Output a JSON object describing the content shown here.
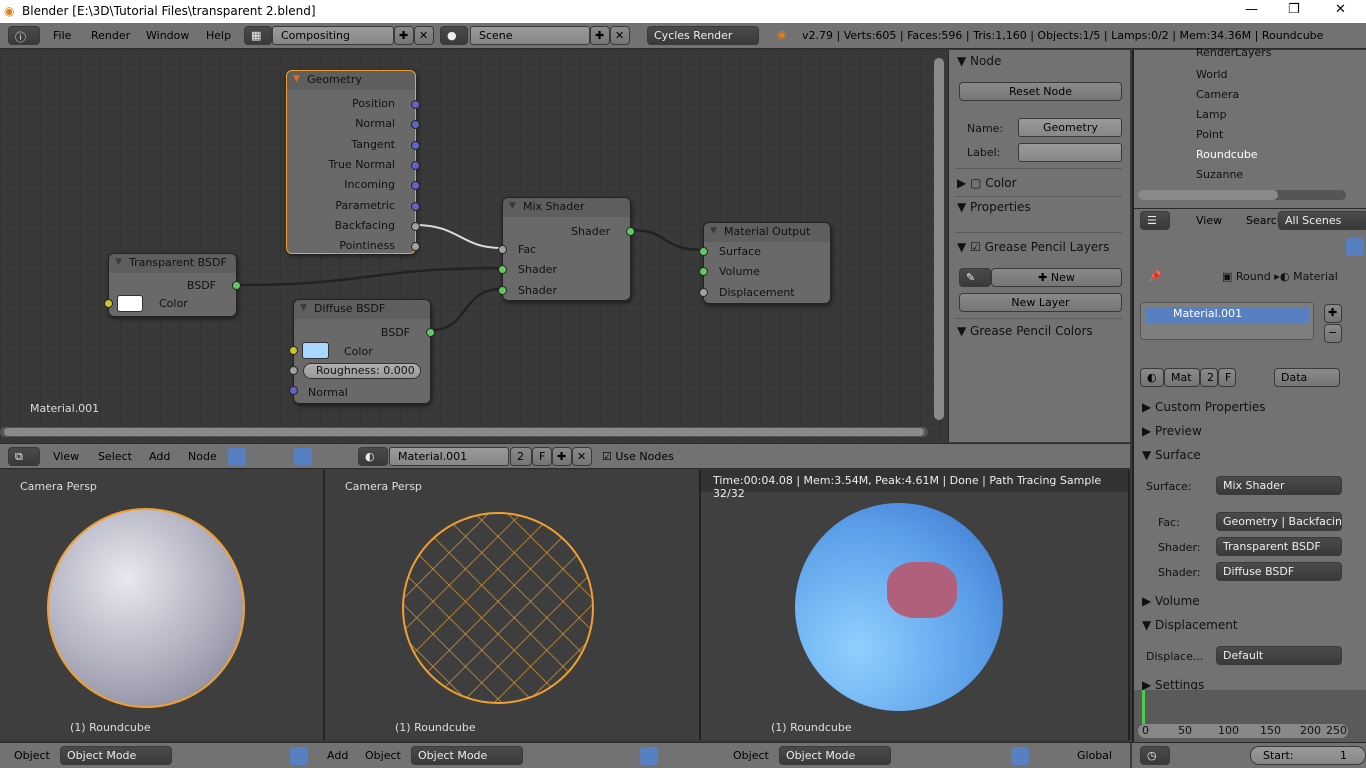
{
  "window": {
    "title": "Blender [E:\\3D\\Tutorial Files\\transparent 2.blend]",
    "minimize": "—",
    "maximize": "❐",
    "close": "✕"
  },
  "topbar": {
    "menus": [
      "File",
      "Render",
      "Window",
      "Help"
    ],
    "layout": "Compositing",
    "scene": "Scene",
    "engine": "Cycles Render",
    "stats": "v2.79 | Verts:605 | Faces:596 | Tris:1,160 | Objects:1/5 | Lamps:0/2 | Mem:34.36M | Roundcube"
  },
  "nodes": {
    "geometry": {
      "title": "Geometry",
      "outputs": [
        "Position",
        "Normal",
        "Tangent",
        "True Normal",
        "Incoming",
        "Parametric",
        "Backfacing",
        "Pointiness"
      ]
    },
    "mix": {
      "title": "Mix Shader",
      "output": "Shader",
      "inputs": [
        "Fac",
        "Shader",
        "Shader"
      ]
    },
    "output": {
      "title": "Material Output",
      "inputs": [
        "Surface",
        "Volume",
        "Displacement"
      ]
    },
    "transparent": {
      "title": "Transparent BSDF",
      "output": "BSDF",
      "color_label": "Color",
      "color": "#ffffff"
    },
    "diffuse": {
      "title": "Diffuse BSDF",
      "output": "BSDF",
      "color_label": "Color",
      "color": "#a8d8ff",
      "roughness": "Roughness:  0.000",
      "normal": "Normal"
    },
    "material_label": "Material.001"
  },
  "sidepanel": {
    "node_header": "Node",
    "reset": "Reset Node",
    "name_label": "Name:",
    "name_value": "Geometry",
    "label_label": "Label:",
    "color": "Color",
    "properties": "Properties",
    "gp_layers": "Grease Pencil Layers",
    "new": "New",
    "new_layer": "New Layer",
    "gp_colors": "Grease Pencil Colors"
  },
  "outliner": {
    "items": [
      "RenderLayers",
      "World",
      "Camera",
      "Lamp",
      "Point",
      "Roundcube",
      "Suzanne"
    ],
    "view": "View",
    "search": "Search",
    "filter": "All Scenes"
  },
  "properties": {
    "breadcrumb": [
      "Round",
      "Material"
    ],
    "slot": "Material.001",
    "mat": "Mat",
    "users": "2",
    "fake": "F",
    "link": "Data",
    "panels": {
      "custom": "Custom Properties",
      "preview": "Preview",
      "surface": "Surface",
      "volume": "Volume",
      "displacement": "Displacement",
      "settings": "Settings"
    },
    "surface_label": "Surface:",
    "surface_value": "Mix Shader",
    "fac_label": "Fac:",
    "fac_value": "Geometry | Backfacing",
    "shader1_label": "Shader:",
    "shader1_value": "Transparent BSDF",
    "shader2_label": "Shader:",
    "shader2_value": "Diffuse BSDF",
    "disp_label": "Displace...",
    "disp_value": "Default"
  },
  "nodebar": {
    "menus": [
      "View",
      "Select",
      "Add",
      "Node"
    ],
    "material": "Material.001",
    "users": "2",
    "fake": "F",
    "use_nodes": "Use Nodes"
  },
  "viewports": [
    {
      "label": "Camera Persp",
      "object": "(1) Roundcube"
    },
    {
      "label": "Camera Persp",
      "object": "(1) Roundcube"
    },
    {
      "label": "Time:00:04.08 | Mem:3.54M, Peak:4.61M | Done | Path Tracing Sample 32/32",
      "object": "(1) Roundcube"
    }
  ],
  "bottom": {
    "object": "Object",
    "mode": "Object Mode",
    "add": "Add",
    "global": "Global"
  },
  "timeline": {
    "ticks": [
      "0",
      "50",
      "100",
      "150",
      "200",
      "250"
    ],
    "start_label": "Start:",
    "start": "1"
  }
}
